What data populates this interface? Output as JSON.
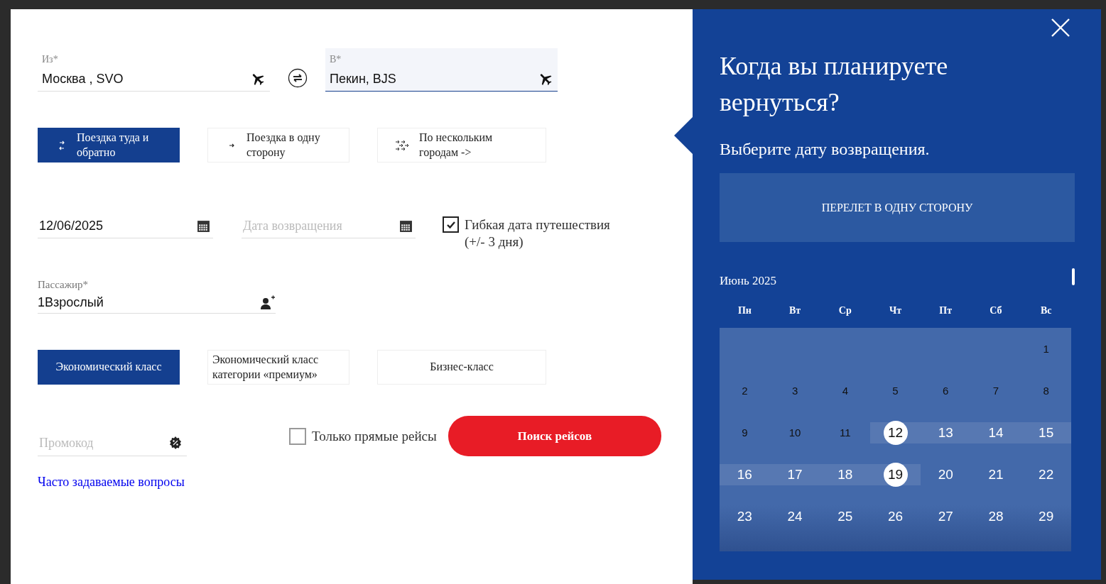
{
  "route": {
    "from": {
      "label": "Из*",
      "value": "Москва , SVO",
      "focused": false
    },
    "to": {
      "label": "В*",
      "value": "Пекин, BJS",
      "focused": true
    }
  },
  "trip_types": [
    {
      "label": "Поездка туда и обратно",
      "kind": "round",
      "selected": true
    },
    {
      "label": "Поездка в одну сторону",
      "kind": "oneway",
      "selected": false
    },
    {
      "label": "По нескольким городам ->",
      "kind": "multi",
      "selected": false
    }
  ],
  "dates": {
    "departure": {
      "value": "12/06/2025"
    },
    "return": {
      "placeholder": "Дата возвращения"
    },
    "flexible": {
      "label": "Гибкая дата путешествия (+/- 3 дня)",
      "checked": true
    }
  },
  "passengers": {
    "label": "Пассажир*",
    "value": "1Взрослый"
  },
  "cabin_classes": [
    {
      "label": "Экономический класс",
      "selected": true
    },
    {
      "label": "Экономический класс категории «премиум»",
      "selected": false
    },
    {
      "label": "Бизнес-класс",
      "selected": false
    }
  ],
  "promo": {
    "placeholder": "Промокод"
  },
  "direct_only": {
    "label": "Только прямые рейсы",
    "checked": false
  },
  "search_button": "Поиск рейсов",
  "faq_link": "Часто задаваемые вопросы",
  "return_panel": {
    "title": "Когда вы планируете вернуться?",
    "subtitle": "Выберите дату возвращения.",
    "one_way_button": "ПЕРЕЛЕТ В ОДНУ СТОРОНУ",
    "calendar": {
      "month": "Июнь 2025",
      "weekdays": [
        "Пн",
        "Вт",
        "Ср",
        "Чт",
        "Пт",
        "Сб",
        "Вс"
      ],
      "weeks": [
        [
          {
            "day": "1",
            "disabled": true,
            "selected": false,
            "in_range": false
          }
        ],
        [
          {
            "day": "2",
            "disabled": true,
            "selected": false,
            "in_range": false
          },
          {
            "day": "3",
            "disabled": true,
            "selected": false,
            "in_range": false
          },
          {
            "day": "4",
            "disabled": true,
            "selected": false,
            "in_range": false
          },
          {
            "day": "5",
            "disabled": true,
            "selected": false,
            "in_range": false
          },
          {
            "day": "6",
            "disabled": true,
            "selected": false,
            "in_range": false
          },
          {
            "day": "7",
            "disabled": true,
            "selected": false,
            "in_range": false
          },
          {
            "day": "8",
            "disabled": true,
            "selected": false,
            "in_range": false
          }
        ],
        [
          {
            "day": "9",
            "disabled": true,
            "selected": false,
            "in_range": false
          },
          {
            "day": "10",
            "disabled": true,
            "selected": false,
            "in_range": false
          },
          {
            "day": "11",
            "disabled": true,
            "selected": false,
            "in_range": false
          },
          {
            "day": "12",
            "disabled": false,
            "selected": true,
            "in_range": true
          },
          {
            "day": "13",
            "disabled": false,
            "selected": false,
            "in_range": true
          },
          {
            "day": "14",
            "disabled": false,
            "selected": false,
            "in_range": true
          },
          {
            "day": "15",
            "disabled": false,
            "selected": false,
            "in_range": true
          }
        ],
        [
          {
            "day": "16",
            "disabled": false,
            "selected": false,
            "in_range": true
          },
          {
            "day": "17",
            "disabled": false,
            "selected": false,
            "in_range": true
          },
          {
            "day": "18",
            "disabled": false,
            "selected": false,
            "in_range": true
          },
          {
            "day": "19",
            "disabled": false,
            "selected": true,
            "in_range": true
          },
          {
            "day": "20",
            "disabled": false,
            "selected": false,
            "in_range": false
          },
          {
            "day": "21",
            "disabled": false,
            "selected": false,
            "in_range": false
          },
          {
            "day": "22",
            "disabled": false,
            "selected": false,
            "in_range": false
          }
        ],
        [
          {
            "day": "23",
            "disabled": false,
            "selected": false,
            "in_range": false
          },
          {
            "day": "24",
            "disabled": false,
            "selected": false,
            "in_range": false
          },
          {
            "day": "25",
            "disabled": false,
            "selected": false,
            "in_range": false
          },
          {
            "day": "26",
            "disabled": false,
            "selected": false,
            "in_range": false
          },
          {
            "day": "27",
            "disabled": false,
            "selected": false,
            "in_range": false
          },
          {
            "day": "28",
            "disabled": false,
            "selected": false,
            "in_range": false
          },
          {
            "day": "29",
            "disabled": false,
            "selected": false,
            "in_range": false
          }
        ]
      ]
    }
  }
}
